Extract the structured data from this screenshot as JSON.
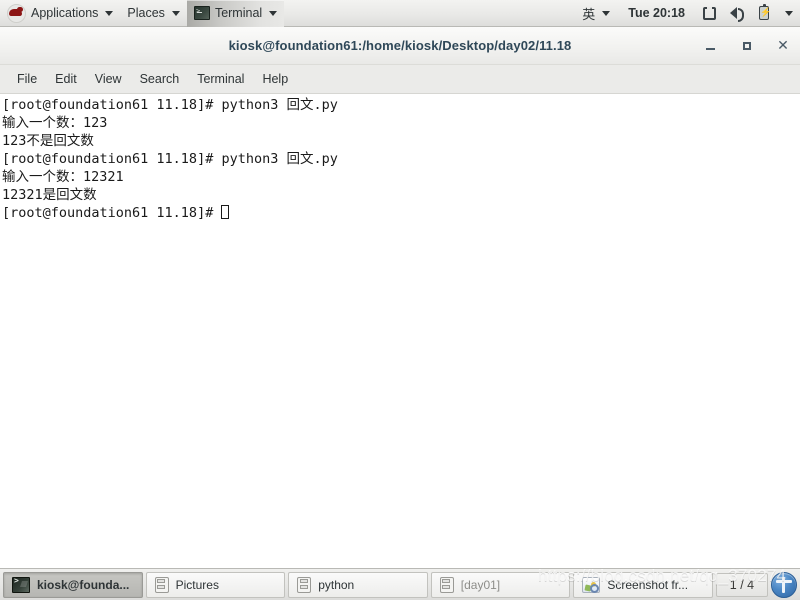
{
  "top_panel": {
    "applications": {
      "label": "Applications",
      "icon": "redhat-logo-icon"
    },
    "places": {
      "label": "Places"
    },
    "active_app": {
      "label": "Terminal",
      "icon": "terminal-icon"
    },
    "input_method": "英",
    "clock": "Tue 20:18",
    "tray": {
      "display": "display-icon",
      "volume": "speaker-icon",
      "battery": "battery-icon",
      "more": "chevron-down-icon"
    }
  },
  "window": {
    "title": "kiosk@foundation61:/home/kiosk/Desktop/day02/11.18",
    "buttons": {
      "minimize": "−",
      "maximize": "□",
      "close": "✕"
    },
    "menu": [
      "File",
      "Edit",
      "View",
      "Search",
      "Terminal",
      "Help"
    ]
  },
  "terminal": {
    "lines": [
      "[root@foundation61 11.18]# python3 回文.py",
      "输入一个数：123",
      "123不是回文数",
      "[root@foundation61 11.18]# python3 回文.py",
      "输入一个数：12321",
      "12321是回文数"
    ],
    "last_prompt": "[root@foundation61 11.18]# ",
    "cursor": "block-cursor"
  },
  "taskbar": {
    "items": [
      {
        "label": "kiosk@founda...",
        "icon": "terminal-icon",
        "state": "active"
      },
      {
        "label": "Pictures",
        "icon": "file-manager-icon",
        "state": "normal"
      },
      {
        "label": "python",
        "icon": "file-manager-icon",
        "state": "normal"
      },
      {
        "label": "[day01]",
        "icon": "file-manager-icon",
        "state": "minimized"
      },
      {
        "label": "Screenshot fr...",
        "icon": "image-viewer-icon",
        "state": "normal"
      }
    ],
    "workspace": "1 / 4",
    "tray_icon": "accessibility-icon"
  },
  "watermark": "https://blog.csdn.net/qq_370274",
  "colors": {
    "panel_bg": "#e9e9e7",
    "menubar_bg": "#ebebe9",
    "terminal_bg": "#ffffff",
    "terminal_fg": "#1a1a1a",
    "title_fg": "#2f4858",
    "accent_blue": "#4a86c4",
    "redhat_red": "#8c1515"
  }
}
